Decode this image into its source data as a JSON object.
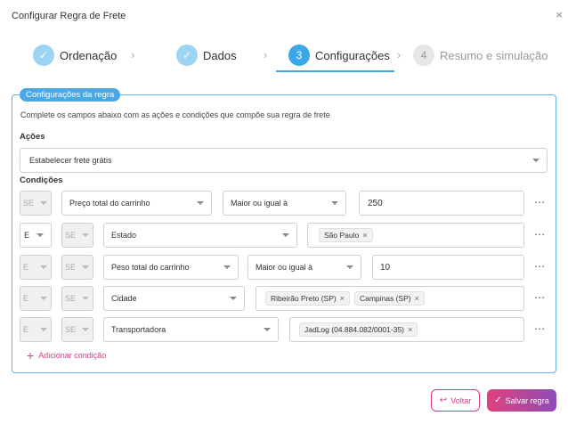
{
  "dialog": {
    "title": "Configurar Regra de Frete",
    "close_icon": "×"
  },
  "steps": [
    {
      "number": "✓",
      "label": "Ordenação",
      "state": "done"
    },
    {
      "number": "✓",
      "label": "Dados",
      "state": "done"
    },
    {
      "number": "3",
      "label": "Configurações",
      "state": "active"
    },
    {
      "number": "4",
      "label": "Resumo e simulação",
      "state": "pending"
    }
  ],
  "panel": {
    "legend": "Configurações da regra",
    "description": "Complete os campos abaixo com as ações e condições que compõe sua regra de frete",
    "actions_label": "Ações",
    "action_value": "Estabelecer frete grátis",
    "conditions_label": "Condições"
  },
  "conditions": [
    {
      "connector": "",
      "prefix": "SE",
      "field": "Preço total do carrinho",
      "operator": "Maior ou igual à",
      "value": "250"
    },
    {
      "connector": "E",
      "prefix": "SE",
      "field": "Estado",
      "tags": [
        "São Paulo"
      ]
    },
    {
      "connector": "E",
      "prefix": "SE",
      "field": "Peso total do carrinho",
      "operator": "Maior ou igual à",
      "value": "10"
    },
    {
      "connector": "E",
      "prefix": "SE",
      "field": "Cidade",
      "tags": [
        "Ribeirão Preto (SP)",
        "Campinas (SP)"
      ]
    },
    {
      "connector": "E",
      "prefix": "SE",
      "field": "Transportadora",
      "tags": [
        "JadLog (04.884.082/0001-35)"
      ]
    }
  ],
  "more_label": "⋯",
  "add_condition": "Adicionar condição",
  "buttons": {
    "back": "Voltar",
    "save": "Salvar regra"
  },
  "colors": {
    "accent": "#3aa7e8",
    "brand_pink": "#d63a8a",
    "gradient_end": "#8e4bb8"
  }
}
